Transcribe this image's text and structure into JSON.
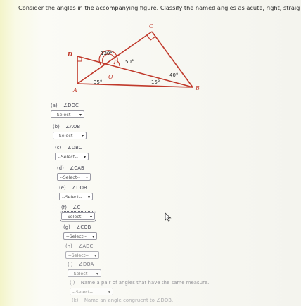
{
  "instruction": "Consider the angles in the accompanying figure. Classify the named angles as acute, right, straight, o",
  "figure": {
    "points": {
      "A": "A",
      "B": "B",
      "C": "C",
      "D": "D",
      "O": "O"
    },
    "angles": {
      "dob": "130°",
      "boc": "50°",
      "b_small": "40°",
      "oab": "35°",
      "oba": "15°"
    }
  },
  "select_placeholder": "--Select--",
  "questions": [
    {
      "letter": "(a)",
      "label": "∠DOC"
    },
    {
      "letter": "(b)",
      "label": "∠AOB"
    },
    {
      "letter": "(c)",
      "label": "∠DBC"
    },
    {
      "letter": "(d)",
      "label": "∠CAB"
    },
    {
      "letter": "(e)",
      "label": "∠DOB"
    },
    {
      "letter": "(f)",
      "label": "∠C"
    },
    {
      "letter": "(g)",
      "label": "∠COB"
    },
    {
      "letter": "(h)",
      "label": "∠ADC"
    },
    {
      "letter": "(i)",
      "label": "∠DOA"
    },
    {
      "letter": "(j)",
      "label": "Name a pair of angles that have the same measure."
    },
    {
      "letter": "(k)",
      "label": "Name an angle congruent to ∠DOB."
    }
  ]
}
